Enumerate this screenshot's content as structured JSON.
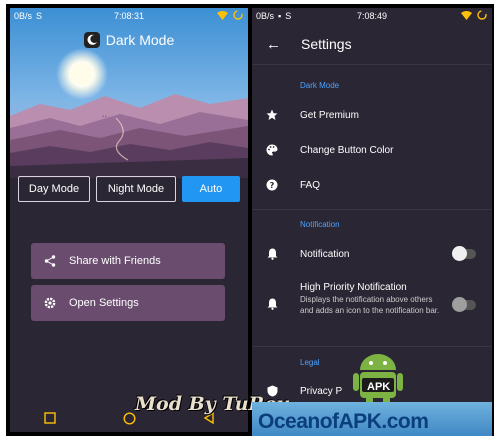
{
  "left": {
    "status": {
      "speed": "0B/s",
      "time": "7:08:31"
    },
    "app_title": "Dark Mode",
    "modes": [
      {
        "label": "Day Mode",
        "active": false
      },
      {
        "label": "Night Mode",
        "active": false
      },
      {
        "label": "Auto",
        "active": true
      }
    ],
    "actions": [
      {
        "label": "Share with Friends",
        "icon": "share-icon"
      },
      {
        "label": "Open Settings",
        "icon": "gear-icon"
      }
    ],
    "nav_icons": [
      "square-icon",
      "circle-icon",
      "back-triangle-icon"
    ]
  },
  "right": {
    "status": {
      "speed": "0B/s",
      "time": "7:08:49"
    },
    "title": "Settings",
    "sections": {
      "dark_mode": "Dark Mode",
      "notification": "Notification",
      "legal": "Legal"
    },
    "items": {
      "get_premium": "Get Premium",
      "change_button_color": "Change Button Color",
      "faq": "FAQ",
      "notification": "Notification",
      "high_priority": "High Priority Notification",
      "high_priority_desc": "Displays the notification above others and adds an icon to the notification bar.",
      "privacy": "Privacy P"
    },
    "toggles": {
      "notification": false,
      "high_priority": false
    }
  },
  "watermark": {
    "text": "Mod By TuReu",
    "brand": "OceanofAPK.com",
    "apk_badge": "APK"
  },
  "colors": {
    "accent": "#2196f3",
    "section": "#4aa3ff",
    "bg": "#2b2634",
    "action": "#6a4d6e"
  }
}
